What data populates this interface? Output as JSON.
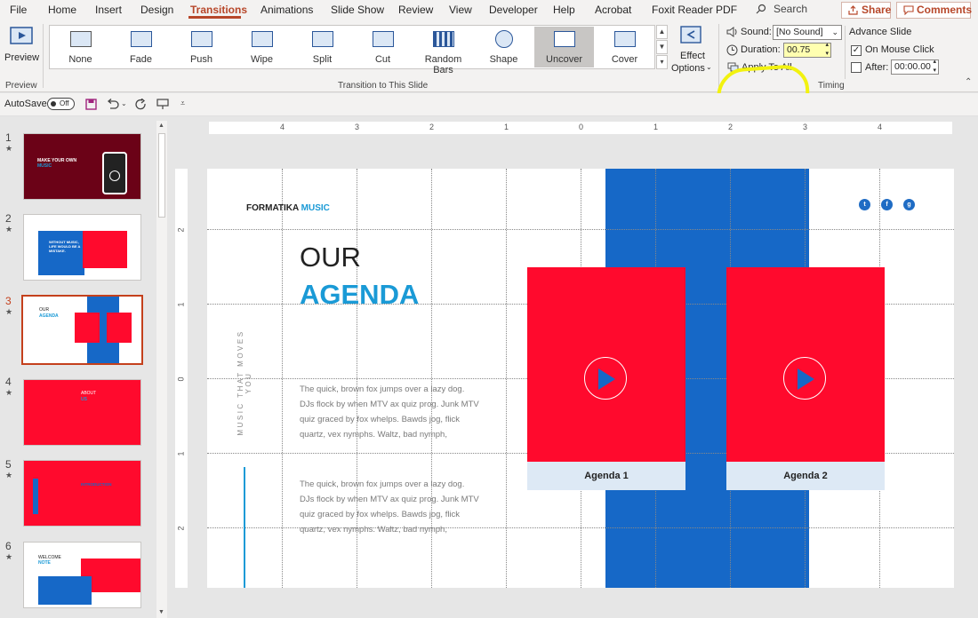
{
  "menu": {
    "items": [
      "File",
      "Home",
      "Insert",
      "Design",
      "Transitions",
      "Animations",
      "Slide Show",
      "Review",
      "View",
      "Developer",
      "Help",
      "Acrobat",
      "Foxit Reader PDF"
    ],
    "search": "Search",
    "share": "Share",
    "comments": "Comments"
  },
  "ribbon": {
    "preview_label": "Preview",
    "preview_group": "Preview",
    "transitions": [
      "None",
      "Fade",
      "Push",
      "Wipe",
      "Split",
      "Cut",
      "Random Bars",
      "Shape",
      "Uncover",
      "Cover"
    ],
    "selected_transition": "Uncover",
    "transition_group": "Transition to This Slide",
    "effect_options_1": "Effect",
    "effect_options_2": "Options",
    "sound_label": "Sound:",
    "sound_value": "[No Sound]",
    "duration_label": "Duration:",
    "duration_value": "00.75",
    "apply_all": "Apply To All",
    "timing_group": "Timing",
    "advance_slide": "Advance Slide",
    "on_mouse_click": "On Mouse Click",
    "on_mouse_click_checked": true,
    "after_label": "After:",
    "after_value": "00:00.00",
    "after_checked": false,
    "highlight_color": "#f2f20f"
  },
  "qat": {
    "autosave_label": "AutoSave",
    "autosave_state": "Off"
  },
  "thumbnails": [
    {
      "num": "1",
      "star": "★"
    },
    {
      "num": "2",
      "star": "★"
    },
    {
      "num": "3",
      "star": "★"
    },
    {
      "num": "4",
      "star": "★"
    },
    {
      "num": "5",
      "star": "★"
    },
    {
      "num": "6",
      "star": "★"
    }
  ],
  "selected_slide": "3",
  "ruler": {
    "top": [
      "4",
      "3",
      "2",
      "1",
      "0",
      "1",
      "2",
      "3",
      "4"
    ],
    "left": [
      "2",
      "1",
      "0",
      "1",
      "2"
    ]
  },
  "slide": {
    "brand_1": "FORMATIKA",
    "brand_2": "MUSIC",
    "title_1": "OUR",
    "title_2": "AGENDA",
    "vertical_text": "MUSIC THAT MOVES YOU",
    "paragraph_1": [
      "The quick, brown fox jumps over a lazy dog.",
      "DJs flock by when MTV ax quiz prog. Junk MTV",
      "quiz graced by fox whelps. Bawds jog, flick",
      "quartz, vex nymphs. Waltz, bad nymph,"
    ],
    "paragraph_2": [
      "The quick, brown fox jumps over a lazy dog.",
      "DJs flock by when MTV ax quiz prog. Junk MTV",
      "quiz graced by fox whelps. Bawds jog, flick",
      "quartz, vex nymphs. Waltz, bad nymph,"
    ],
    "agenda_1": "Agenda 1",
    "agenda_2": "Agenda 2",
    "colors": {
      "red": "#ff0a2d",
      "blue": "#1668c7",
      "accent_text": "#1a9ad6",
      "selection_border": "#c4401c"
    }
  },
  "thumb_text": {
    "s1_line1": "MAKE YOUR OWN",
    "s1_line2": "MUSIC",
    "s2_text": "WITHOUT MUSIC, LIFE WOULD BE A MISTAKE.",
    "s3_line1": "OUR",
    "s3_line2": "AGENDA",
    "s4_line1": "ABOUT",
    "s4_line2": "US",
    "s5_text": "INTRODUCTION",
    "s6_line1": "WELCOME",
    "s6_line2": "NOTE"
  }
}
